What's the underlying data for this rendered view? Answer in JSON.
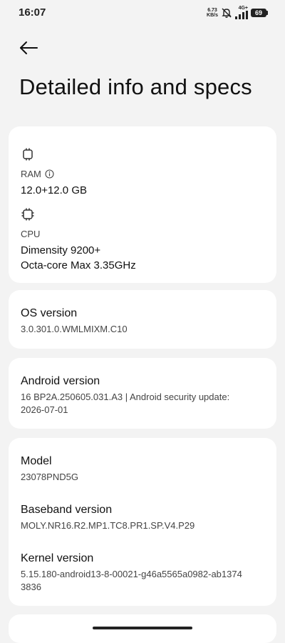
{
  "status_bar": {
    "time": "16:07",
    "net_speed_value": "6.73",
    "net_speed_unit": "KB/s",
    "network_type": "4G+",
    "battery": "69"
  },
  "header": {
    "title": "Detailed info and specs"
  },
  "hardware": {
    "ram_label": "RAM",
    "ram_value": "12.0+12.0 GB",
    "cpu_label": "CPU",
    "cpu_value_line1": "Dimensity 9200+",
    "cpu_value_line2": "Octa-core Max 3.35GHz"
  },
  "os": {
    "title": "OS version",
    "value": "3.0.301.0.WMLMIXM.C10"
  },
  "android": {
    "title": "Android version",
    "value_line1": "16 BP2A.250605.031.A3 | Android security update:",
    "value_line2": "2026-07-01"
  },
  "device": {
    "model_title": "Model",
    "model_value": "23078PND5G",
    "baseband_title": "Baseband version",
    "baseband_value": "MOLY.NR16.R2.MP1.TC8.PR1.SP.V4.P29",
    "kernel_title": "Kernel version",
    "kernel_value_line1": "5.15.180-android13-8-00021-g46a5565a0982-ab1374",
    "kernel_value_line2": "3836"
  }
}
